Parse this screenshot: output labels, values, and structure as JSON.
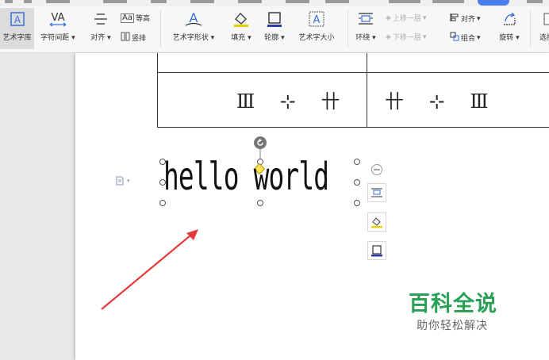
{
  "ribbon": {
    "artlib": {
      "label": "艺术字库"
    },
    "spacing": {
      "label": "字符间距",
      "icon": "VA"
    },
    "align": {
      "label": "对齐"
    },
    "equal_height": {
      "label": "等高",
      "icon": "Aa"
    },
    "vertical": {
      "label": "竖排"
    },
    "shape": {
      "label": "艺术字形状",
      "icon": "A"
    },
    "fill": {
      "label": "填充"
    },
    "outline": {
      "label": "轮廓"
    },
    "size": {
      "label": "艺术字大小",
      "icon": "A"
    },
    "wrap": {
      "label": "环绕"
    },
    "bring_forward": {
      "label": "上移一层"
    },
    "send_backward": {
      "label": "下移一层"
    },
    "align2": {
      "label": "对齐"
    },
    "group": {
      "label": "组合"
    },
    "rotate": {
      "label": "旋转"
    },
    "select": {
      "label": "选择"
    }
  },
  "table": {
    "left_cell": "Ⅲ ⊹ 卄",
    "right_cell": "卄 ⊹ Ⅲ"
  },
  "wordart": {
    "text": "hello world"
  },
  "watermark": {
    "title": "百科全说",
    "subtitle": "助你轻松解决"
  },
  "colors": {
    "accent": "#4a7df0",
    "watermark_green": "#2aa056",
    "arrow_red": "#e63a3a"
  }
}
